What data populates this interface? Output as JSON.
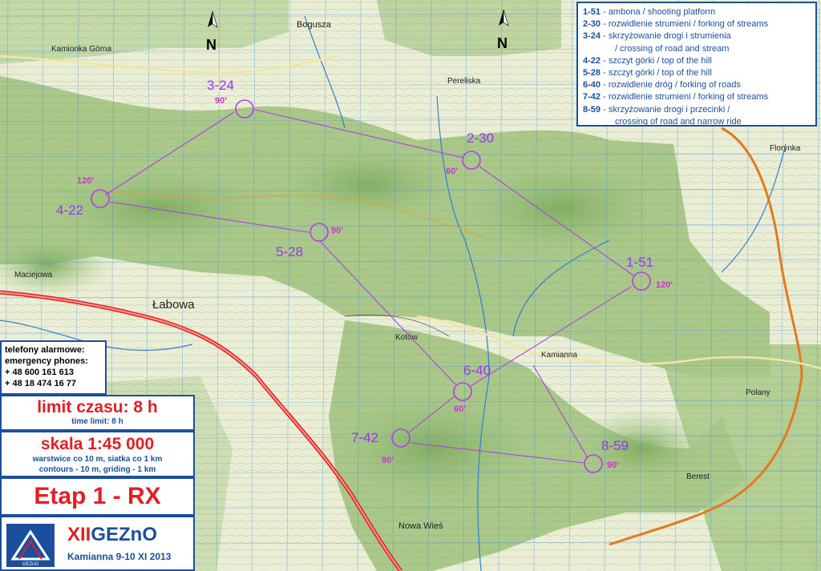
{
  "map": {
    "places": [
      {
        "id": "bogusza",
        "label": "Bogusza"
      },
      {
        "id": "kamionka",
        "label": "Kamionka Górna"
      },
      {
        "id": "pereliska",
        "label": "Pereliska"
      },
      {
        "id": "florynka",
        "label": "Florynka"
      },
      {
        "id": "maciejowa",
        "label": "Maciejowa"
      },
      {
        "id": "labowa",
        "label": "Łabowa"
      },
      {
        "id": "kotow",
        "label": "Kotów"
      },
      {
        "id": "kamianna",
        "label": "Kamianna"
      },
      {
        "id": "polany",
        "label": "Polany"
      },
      {
        "id": "berest",
        "label": "Berest"
      },
      {
        "id": "nowawies",
        "label": "Nowa Wieś"
      }
    ],
    "checkpoints": [
      {
        "code": "3-24",
        "angle": "90'"
      },
      {
        "code": "2-30",
        "angle": "60'"
      },
      {
        "code": "4-22",
        "angle": "120'"
      },
      {
        "code": "5-28",
        "angle": "90'"
      },
      {
        "code": "1-51",
        "angle": "120'"
      },
      {
        "code": "6-40",
        "angle": "60'"
      },
      {
        "code": "7-42",
        "angle": "90'"
      },
      {
        "code": "8-59",
        "angle": "90'"
      }
    ],
    "north_label": "N"
  },
  "legend": {
    "items": [
      {
        "code": "1-51",
        "text": "ambona / shooting platform"
      },
      {
        "code": "2-30",
        "text": "rozwidlenie strumieni / forking of streams"
      },
      {
        "code": "3-24",
        "text": "skrzyżowanie drogi i strumienia"
      },
      {
        "code": "",
        "text": "/ crossing of road and stream"
      },
      {
        "code": "4-22",
        "text": "szczyt górki / top of the hill"
      },
      {
        "code": "5-28",
        "text": "szczyt górki / top of the hill"
      },
      {
        "code": "6-40",
        "text": "rozwidlenie dróg / forking of roads"
      },
      {
        "code": "7-42",
        "text": "rozwidlenie strumieni / forking of streams"
      },
      {
        "code": "8-59",
        "text": "skrzyżowanie drogi i przecinki /"
      },
      {
        "code": "",
        "text": "crossing of road and narrow ride"
      }
    ]
  },
  "emergency": {
    "title_pl": "telefony alarmowe:",
    "title_en": "emergency phones:",
    "phones": [
      "+ 48 600 161 613",
      "+ 48 18 474 16 77"
    ]
  },
  "time_limit": {
    "label_pl": "limit czasu: 8 h",
    "label_en": "time limit: 8 h"
  },
  "scale": {
    "label": "skala 1:45 000",
    "line1": "warstwice co 10 m, siatka co 1 km",
    "line2": "contours - 10 m,  griding - 1 km"
  },
  "stage": {
    "label": "Etap 1 - RX"
  },
  "event": {
    "roman": "XII",
    "name": "GEZnO",
    "sub": "Kamianna 9-10 XI 2013",
    "logo_text": "GEZnO"
  },
  "colors": {
    "forest": "#a8c98a",
    "open": "#eef2dc",
    "road_main": "#e31e24",
    "stream": "#2f7fd6",
    "course": "#b13ee6",
    "panel_border": "#1b4e9c"
  }
}
